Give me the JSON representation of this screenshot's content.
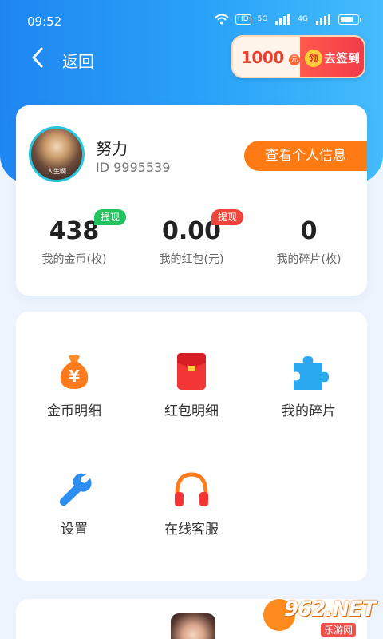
{
  "status_bar": {
    "time": "09:52",
    "hd_label": "HD",
    "net_1": "5G",
    "net_2": "4G"
  },
  "header": {
    "back_label": "返回",
    "signin": {
      "amount": "1000",
      "unit": "元",
      "badge": "领",
      "label": "去签到"
    }
  },
  "profile": {
    "name": "努力",
    "id_text": "ID 9995539",
    "avatar_caption": "人生啊",
    "view_button": "查看个人信息"
  },
  "stats": [
    {
      "value": "438",
      "label": "我的金币(枚)",
      "tag": "提现",
      "tag_color": "#22c35e"
    },
    {
      "value": "0.00",
      "label": "我的红包(元)",
      "tag": "提现",
      "tag_color": "#f0433a"
    },
    {
      "value": "0",
      "label": "我的碎片(枚)"
    }
  ],
  "menu": [
    {
      "label": "金币明细",
      "icon": "coin-bag-icon"
    },
    {
      "label": "红包明细",
      "icon": "red-envelope-icon"
    },
    {
      "label": "我的碎片",
      "icon": "puzzle-piece-icon"
    },
    {
      "label": "设置",
      "icon": "wrench-icon"
    },
    {
      "label": "在线客服",
      "icon": "headphones-icon"
    }
  ],
  "watermark": {
    "logo_text": "962.NET",
    "sub_text": "乐游网"
  },
  "colors": {
    "header_gradient_start": "#1f86f1",
    "header_gradient_end": "#45bcfc",
    "accent_orange": "#ff7a12",
    "tag_green": "#22c35e",
    "tag_red": "#f0433a"
  }
}
